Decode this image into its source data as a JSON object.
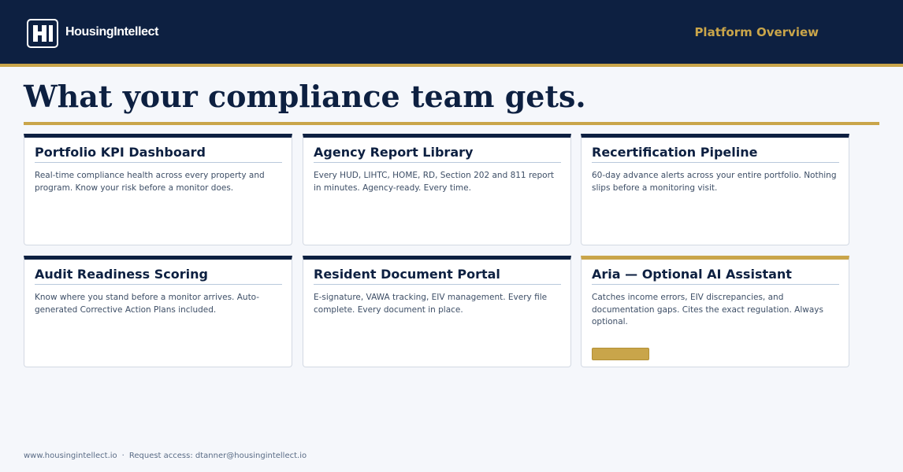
{
  "header": {
    "brand_name": "HousingIntellect",
    "nav_label": "Platform Overview"
  },
  "main": {
    "title": "What your compliance team gets.",
    "cards": [
      {
        "title": "Portfolio KPI Dashboard",
        "description": "Real-time compliance health across every property and program. Know your risk before a monitor does."
      },
      {
        "title": "Agency Report Library",
        "description": "Every HUD, LIHTC, HOME, RD, Section 202 and 811 report in minutes. Agency-ready. Every time."
      },
      {
        "title": "Recertification Pipeline",
        "description": "60-day advance alerts across your entire portfolio. Nothing slips before a monitoring visit."
      },
      {
        "title": "Audit Readiness Scoring",
        "description": "Know where you stand before a monitor arrives. Auto-generated Corrective Action Plans included."
      },
      {
        "title": "Resident Document Portal",
        "description": "E-signature, VAWA tracking, EIV management. Every file complete. Every document in place."
      },
      {
        "title": "Aria — Optional AI Assistant",
        "description": "Catches income errors, EIV discrepancies, and documentation gaps. Cites the exact regulation. Always optional."
      }
    ]
  },
  "footer": {
    "website": "www.housingintellect.io",
    "separator": "·",
    "contact": "Request access: dtanner@housingintellect.io"
  },
  "colors": {
    "navy": "#0d2041",
    "gold": "#c9a54a",
    "background": "#f5f7fb"
  },
  "icons": {
    "logo": "hi-monogram-icon"
  }
}
